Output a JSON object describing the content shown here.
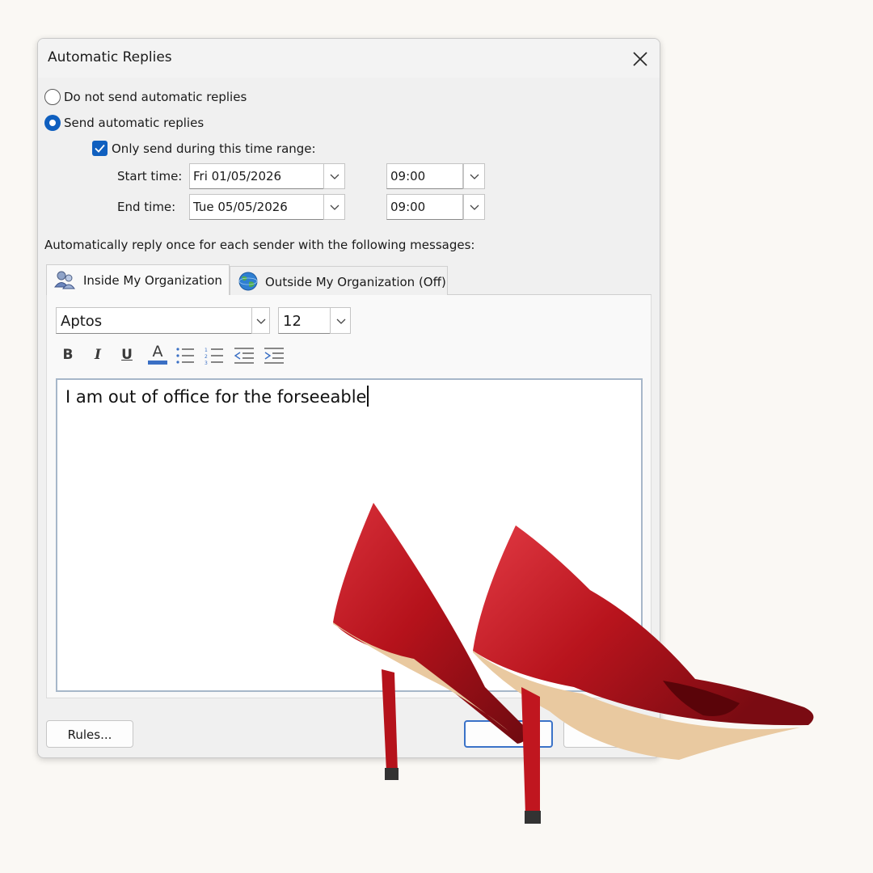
{
  "window": {
    "title": "Automatic Replies"
  },
  "options": {
    "no_reply_label": "Do not send automatic replies",
    "send_label": "Send automatic replies",
    "time_range_label": "Only send during this time range:",
    "no_reply_checked": false,
    "send_checked": true,
    "time_range_checked": true
  },
  "schedule": {
    "start_label": "Start time:",
    "start_date": "Fri 01/05/2026",
    "start_time": "09:00",
    "end_label": "End time:",
    "end_date": "Tue 05/05/2026",
    "end_time": "09:00"
  },
  "instructions": "Automatically reply once for each sender with the following messages:",
  "tabs": [
    {
      "label": "Inside My Organization",
      "icon": "people-icon",
      "active": true
    },
    {
      "label": "Outside My Organization (Off)",
      "icon": "globe-icon",
      "active": false
    }
  ],
  "toolbar": {
    "font": "Aptos",
    "size": "12",
    "bold": "B",
    "italic": "I",
    "underline": "U",
    "font_color_glyph": "A"
  },
  "message": {
    "text": "I am out of office for the forseeable"
  },
  "footer": {
    "rules_label": "Rules..."
  },
  "colors": {
    "accent": "#0f5fbf",
    "shoe": "#b5121b"
  }
}
